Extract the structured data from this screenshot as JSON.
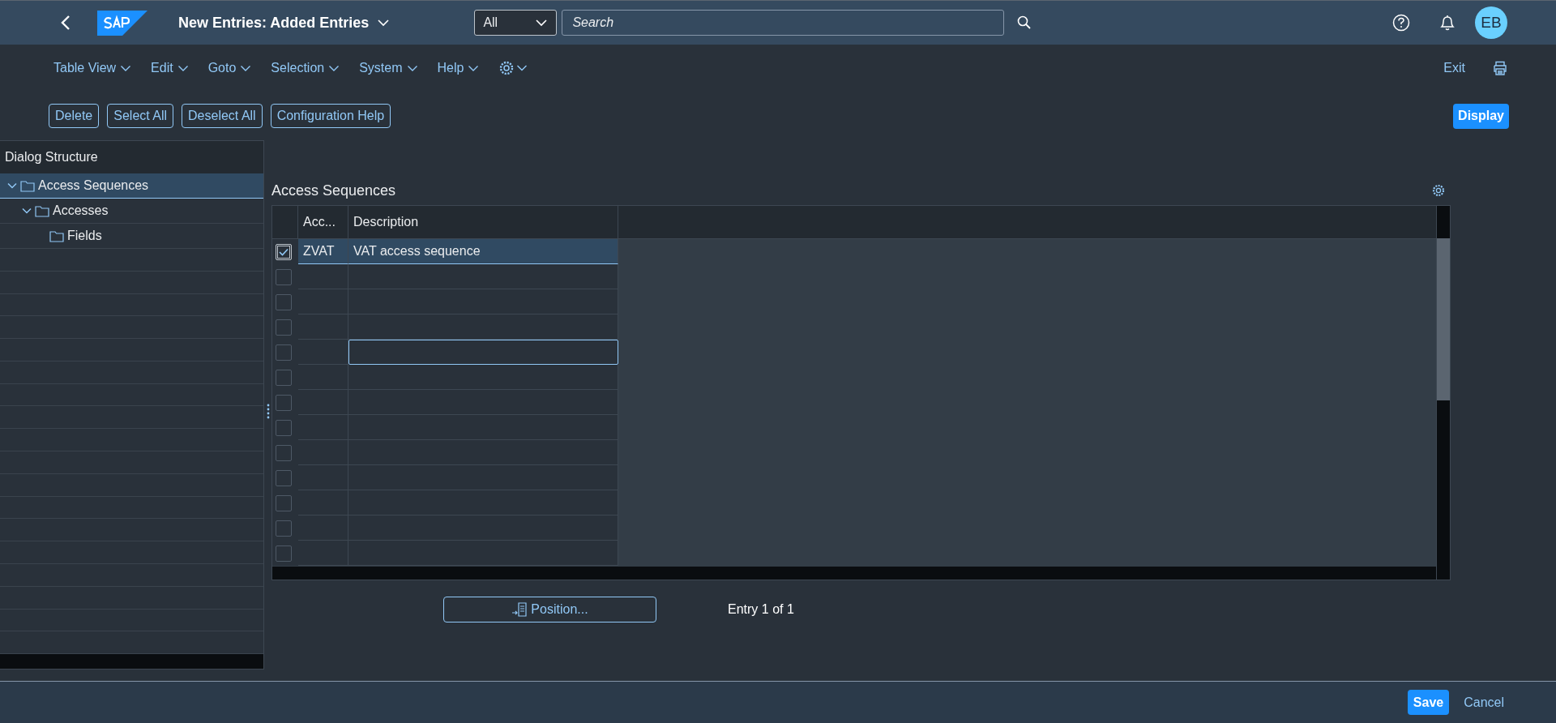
{
  "shell": {
    "title": "New Entries: Added Entries",
    "search_scope": "All",
    "search": {
      "placeholder": "Search"
    },
    "avatar": "EB"
  },
  "menu": [
    "Table View",
    "Edit",
    "Goto",
    "Selection",
    "System",
    "Help"
  ],
  "exit": "Exit",
  "toolbar": [
    "Delete",
    "Select All",
    "Deselect All",
    "Configuration Help"
  ],
  "display_button": "Display",
  "dialog_structure": {
    "title": "Dialog Structure",
    "tree": [
      {
        "label": "Access Sequences",
        "expanded": true,
        "selected": true,
        "children": [
          {
            "label": "Accesses",
            "expanded": true,
            "selected": false,
            "children": [
              {
                "label": "Fields",
                "selected": false
              }
            ]
          }
        ]
      }
    ]
  },
  "table": {
    "title": "Access Sequences",
    "columns": [
      "Acc...",
      "Description"
    ],
    "rows": [
      {
        "checked": true,
        "focused": false,
        "access": "ZVAT",
        "description": "VAT access sequence"
      },
      {
        "checked": false,
        "focused": false
      },
      {
        "checked": false,
        "focused": false
      },
      {
        "checked": false,
        "focused": false
      },
      {
        "checked": false,
        "focused": true
      },
      {
        "checked": false,
        "focused": false
      },
      {
        "checked": false,
        "focused": false
      },
      {
        "checked": false,
        "focused": false
      },
      {
        "checked": false,
        "focused": false
      },
      {
        "checked": false,
        "focused": false
      },
      {
        "checked": false,
        "focused": false
      },
      {
        "checked": false,
        "focused": false
      },
      {
        "checked": false,
        "focused": false
      }
    ]
  },
  "position_button": "Position...",
  "entry_count": "Entry 1 of 1",
  "footer": {
    "save": "Save",
    "cancel": "Cancel"
  }
}
